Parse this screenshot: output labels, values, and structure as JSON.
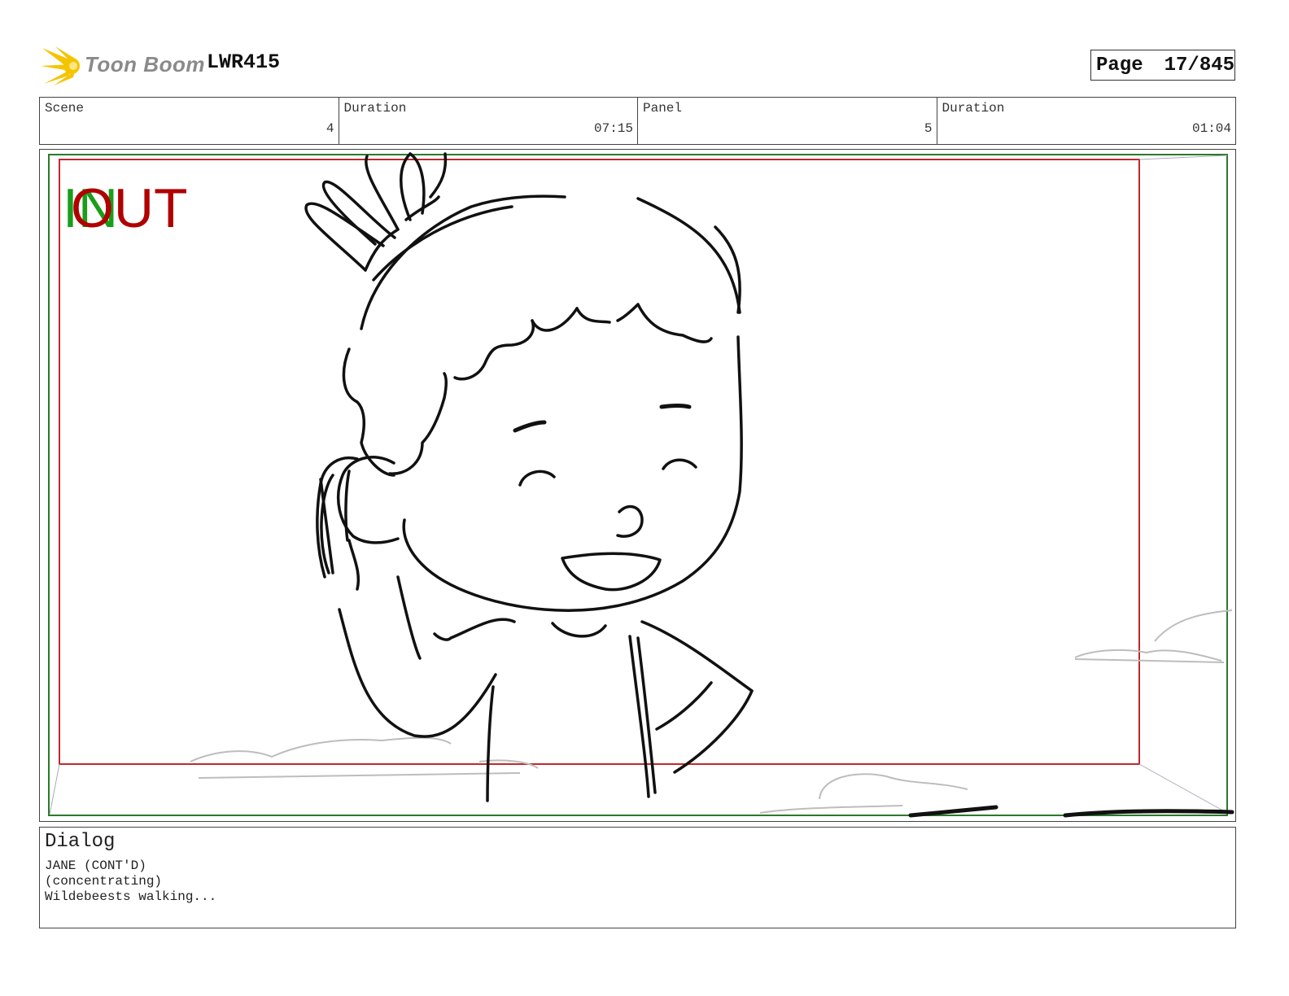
{
  "header": {
    "logo_text": "Toon Boom",
    "production_code": "LWR415",
    "page_label": "Page",
    "page_number": "17/845"
  },
  "info": {
    "scene_label": "Scene",
    "scene_value": "4",
    "scene_duration_label": "Duration",
    "scene_duration_value": "07:15",
    "panel_label": "Panel",
    "panel_value": "5",
    "panel_duration_label": "Duration",
    "panel_duration_value": "01:04"
  },
  "frame": {
    "in_label": "IN",
    "out_label": "OUT",
    "colors": {
      "in": "#1a9e1a",
      "out": "#b00000",
      "camera_box": "#2a7a2a",
      "title_safe": "#c0282d"
    }
  },
  "dialog": {
    "title": "Dialog",
    "character": "JANE (CONT'D)",
    "direction": "(concentrating)",
    "line": "Wildebeests walking..."
  }
}
